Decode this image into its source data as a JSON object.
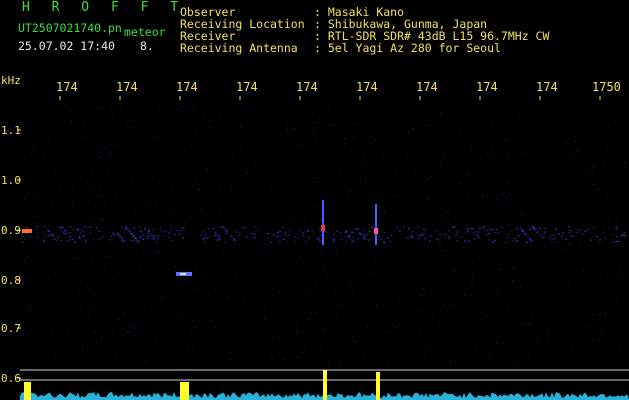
{
  "header": {
    "title": "H R O F F T",
    "filename": "UT2507021740.pn",
    "meteor_label": "meteor",
    "datetime": "25.07.02 17:40",
    "count": "8.",
    "fields": [
      {
        "label": "Observer",
        "value": ": Masaki Kano"
      },
      {
        "label": "Receiving Location",
        "value": ": Shibukawa, Gunma, Japan"
      },
      {
        "label": "Receiver",
        "value": ": RTL-SDR SDR# 43dB L15 96.7MHz CW"
      },
      {
        "label": "Receiving Antenna",
        "value": ": 5el Yagi Az 280 for Seoul"
      }
    ]
  },
  "chart_data": {
    "type": "heatmap",
    "ylabel": "kHz",
    "y_ticks": [
      "1.1",
      "1.0",
      "0.9",
      "0.8",
      "0.7",
      "0.6"
    ],
    "x_ticks": [
      "174",
      "174",
      "174",
      "174",
      "174",
      "174",
      "174",
      "174",
      "174",
      "1750"
    ],
    "colors": {
      "text": "#f0e060",
      "background": "#000000",
      "power_trace": "#30d0ff",
      "peak": "#ffff30"
    }
  }
}
